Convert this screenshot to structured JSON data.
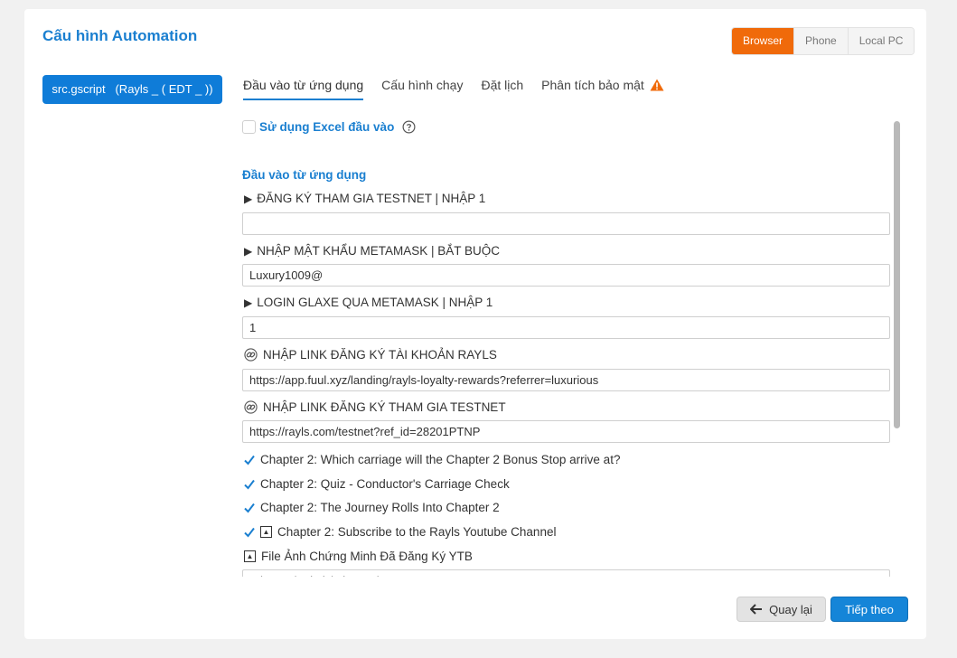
{
  "page": {
    "title": "Cấu hình Automation"
  },
  "modes": [
    {
      "label": "Browser",
      "active": true
    },
    {
      "label": "Phone",
      "active": false
    },
    {
      "label": "Local PC",
      "active": false
    }
  ],
  "script_button": {
    "label": "src.gscript   (Rayls _ ( EDT _ ))"
  },
  "tabs": [
    {
      "label": "Đầu vào từ ứng dụng",
      "active": true
    },
    {
      "label": "Cấu hình chạy",
      "active": false
    },
    {
      "label": "Đặt lịch",
      "active": false
    },
    {
      "label": "Phân tích bảo mật",
      "active": false,
      "icon": "warning-icon"
    }
  ],
  "excel": {
    "label": "Sử dụng Excel đầu vào",
    "checked": false
  },
  "section": {
    "title": "Đầu vào từ ứng dụng"
  },
  "fields": [
    {
      "icon": "play-triangle-icon",
      "glyph": "▶",
      "label": "ĐĂNG KÝ THAM GIA TESTNET | NHẬP 1",
      "value": ""
    },
    {
      "icon": "play-triangle-icon",
      "glyph": "▶",
      "label": "NHẬP MẬT KHẨU METAMASK | BẮT BUỘC",
      "value": "Luxury1009@"
    },
    {
      "icon": "play-triangle-icon",
      "glyph": "▶",
      "label": "LOGIN GLAXE QUA METAMASK | NHẬP 1",
      "value": "1"
    },
    {
      "icon": "link-icon",
      "label": "NHẬP LINK ĐĂNG KÝ TÀI KHOẢN RAYLS",
      "value": "https://app.fuul.xyz/landing/rayls-loyalty-rewards?referrer=luxurious"
    },
    {
      "icon": "link-icon",
      "label": "NHẬP LINK ĐĂNG KÝ THAM GIA TESTNET",
      "value": "https://rayls.com/testnet?ref_id=28201PTNP"
    }
  ],
  "checks": [
    {
      "label": "Chapter 2: Which carriage will the Chapter 2 Bonus Stop arrive at?",
      "checked": true
    },
    {
      "label": "Chapter 2: Quiz - Conductor's Carriage Check",
      "checked": true
    },
    {
      "label": "Chapter 2: The Journey Rolls Into Chapter 2",
      "checked": true
    },
    {
      "label": "Chapter 2: Subscribe to the Rayls Youtube Channel",
      "checked": true,
      "icon": "up-box-icon"
    }
  ],
  "file_field": {
    "icon": "up-box-icon",
    "label": "File Ảnh Chứng Minh Đã Đăng Ký YTB",
    "value": "C:\\Users\\Admin\\Pictures\\YTB"
  },
  "footer": {
    "back_label": "Quay lại",
    "next_label": "Tiếp theo"
  },
  "colors": {
    "accent": "#1a7fd0",
    "browser_active": "#f06a0a",
    "primary_button": "#1585d8",
    "warning": "#f06a0a"
  }
}
